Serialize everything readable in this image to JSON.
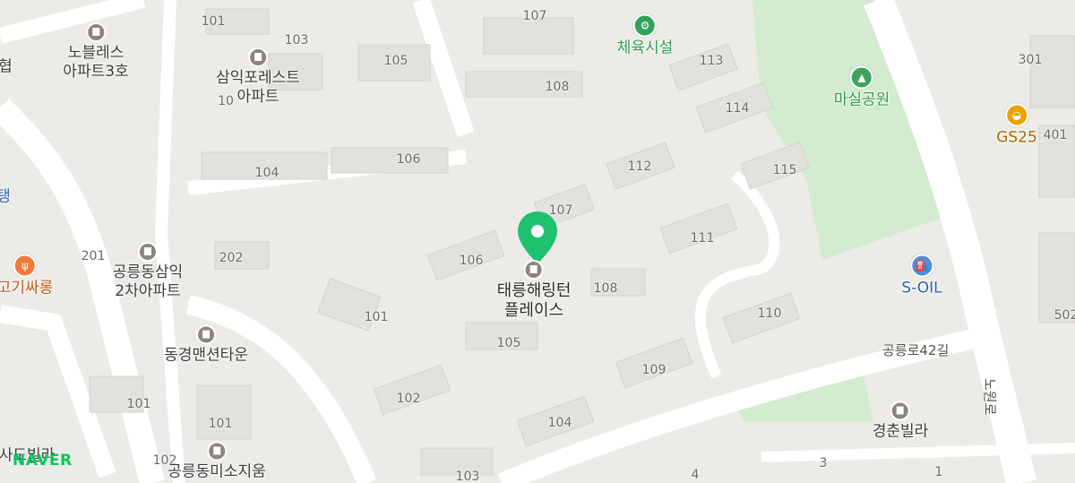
{
  "provider": "NAVER",
  "selected_place": {
    "name_line1": "태릉해링턴",
    "name_line2": "플레이스",
    "pin_color": "#1fc06e"
  },
  "pois": {
    "gym": "체육시설",
    "park": "마실공원",
    "gs25": "GS25",
    "soil": "S-OIL",
    "nobles": [
      "노블레스",
      "아파트3호"
    ],
    "samik_forest": [
      "삼익포레스트",
      "아파트"
    ],
    "gongneung_samik": [
      "공릉동삼익",
      "2차아파트"
    ],
    "donggyeong": "동경맨션타운",
    "gyeongchun": "경춘빌라",
    "gogi": "고기싸롱",
    "misoji": "공릉동미소지움",
    "edge_left_top": "협",
    "edge_left_mid": "탱",
    "edge_left_bottom": "사도빌라"
  },
  "roads": {
    "gongneung42": "공릉로42길",
    "nowon": "노원로"
  },
  "building_numbers": [
    "107",
    "113",
    "108",
    "114",
    "112",
    "115",
    "107",
    "111",
    "106",
    "108",
    "110",
    "101",
    "105",
    "109",
    "102",
    "104",
    "103",
    "101",
    "103",
    "105",
    "104",
    "106",
    "202",
    "201",
    "101",
    "101",
    "102",
    "301",
    "401",
    "502",
    "3",
    "4",
    "1",
    "10"
  ],
  "colors": {
    "background": "#ecebe8",
    "park": "#d3ebcf",
    "road": "#ffffff",
    "building": "#e2e0dc"
  }
}
